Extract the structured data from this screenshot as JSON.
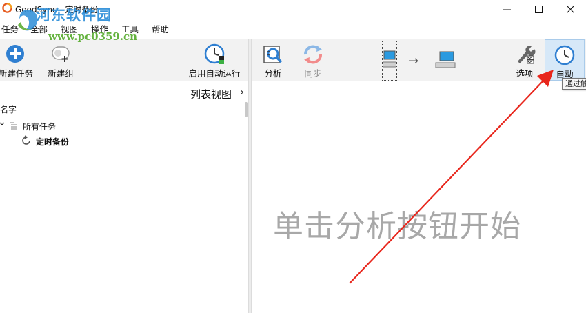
{
  "window": {
    "title": "GoodSync - 定时备份",
    "controls": [
      "minimize",
      "maximize",
      "close"
    ]
  },
  "watermark": {
    "site_name": "河东软件园",
    "url": "www.pc0359.cn"
  },
  "menu": [
    {
      "label": "任务"
    },
    {
      "label": "全部"
    },
    {
      "label": "视图"
    },
    {
      "label": "操作"
    },
    {
      "label": "工具"
    },
    {
      "label": "帮助"
    }
  ],
  "left_toolbar": {
    "new_job": "新建任务",
    "new_group": "新建组",
    "enable_auto": "启用自动运行"
  },
  "list_view": {
    "title": "列表视图",
    "chevron": "›",
    "column_name": "名字"
  },
  "tree": {
    "all_jobs": "所有任务",
    "job": "定时备份"
  },
  "right_toolbar": {
    "analyze": "分析",
    "sync": "同步",
    "sync_arrow": "→",
    "options": "选项",
    "auto": "自动"
  },
  "tooltip": "通过触",
  "main_hint": "单击分析按钮开始",
  "icons": {
    "app": "goodsync-logo-icon",
    "new_job": "plus-circle-icon",
    "new_group": "group-add-icon",
    "enable_auto": "clock-icon",
    "analyze": "analyze-icon",
    "sync": "sync-icon",
    "left_folder": "computer-icon",
    "right_folder": "computer-icon",
    "options": "wrench-icon",
    "auto": "clock-icon"
  },
  "colors": {
    "accent_blue": "#2f7fd1",
    "annotation_red": "#e8261c",
    "watermark_blue": "#2c8ed8",
    "watermark_green": "#54aa2a"
  }
}
